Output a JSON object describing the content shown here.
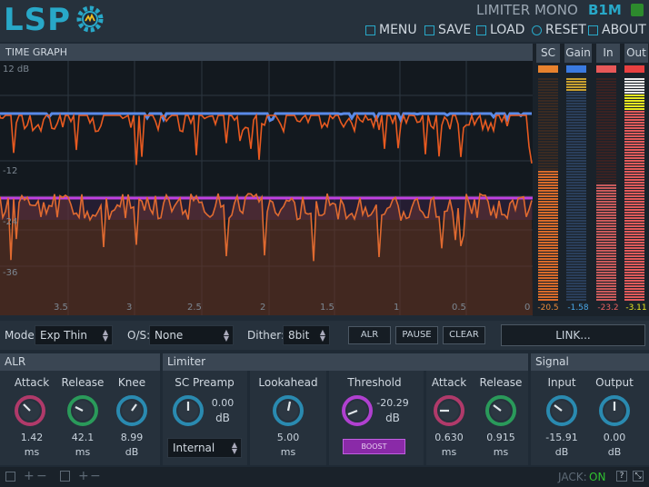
{
  "header": {
    "logo": "LSP",
    "title": "LIMITER MONO",
    "id": "B1M",
    "menu": [
      {
        "label": "MENU",
        "icon": "menu-icon"
      },
      {
        "label": "SAVE",
        "icon": "save-icon"
      },
      {
        "label": "LOAD",
        "icon": "load-icon"
      },
      {
        "label": "RESET",
        "icon": "reset-icon"
      },
      {
        "label": "ABOUT",
        "icon": "about-icon"
      }
    ]
  },
  "time_graph": {
    "title": "TIME GRAPH",
    "y_labels": [
      "12 dB",
      "-12",
      "-24",
      "-36"
    ],
    "x_labels": [
      "3.5",
      "3",
      "2.5",
      "2",
      "1.5",
      "1",
      "0.5",
      "0"
    ]
  },
  "meters": [
    {
      "label": "SC",
      "value": "-20.5",
      "value_color": "#e88a3a"
    },
    {
      "label": "Gain",
      "value": "-1.58",
      "value_color": "#4aa8e8"
    },
    {
      "label": "In",
      "value": "-23.2",
      "value_color": "#e86060"
    },
    {
      "label": "Out",
      "value": "-3.11",
      "value_color": "#e8e820"
    }
  ],
  "controls": {
    "mode_label": "Mode:",
    "mode_value": "Exp Thin",
    "os_label": "O/S:",
    "os_value": "None",
    "dither_label": "Dither:",
    "dither_value": "8bit",
    "alr_button": "ALR",
    "pause_button": "PAUSE",
    "clear_button": "CLEAR",
    "link_button": "LINK..."
  },
  "alr": {
    "title": "ALR",
    "attack": {
      "label": "Attack",
      "value": "1.42",
      "unit": "ms"
    },
    "release": {
      "label": "Release",
      "value": "42.1",
      "unit": "ms"
    },
    "knee": {
      "label": "Knee",
      "value": "8.99",
      "unit": "dB"
    }
  },
  "limiter": {
    "title": "Limiter",
    "sc_preamp": {
      "label": "SC Preamp",
      "value": "0.00",
      "unit": "dB"
    },
    "sc_source": "Internal",
    "lookahead": {
      "label": "Lookahead",
      "value": "5.00",
      "unit": "ms"
    },
    "threshold": {
      "label": "Threshold",
      "value": "-20.29",
      "unit": "dB"
    },
    "boost_button": "BOOST",
    "attack": {
      "label": "Attack",
      "value": "0.630",
      "unit": "ms"
    },
    "release": {
      "label": "Release",
      "value": "0.915",
      "unit": "ms"
    }
  },
  "signal": {
    "title": "Signal",
    "input": {
      "label": "Input",
      "value": "-15.91",
      "unit": "dB"
    },
    "output": {
      "label": "Output",
      "value": "0.00",
      "unit": "dB"
    }
  },
  "footer": {
    "jack_label": "JACK:",
    "jack_status": "ON"
  }
}
